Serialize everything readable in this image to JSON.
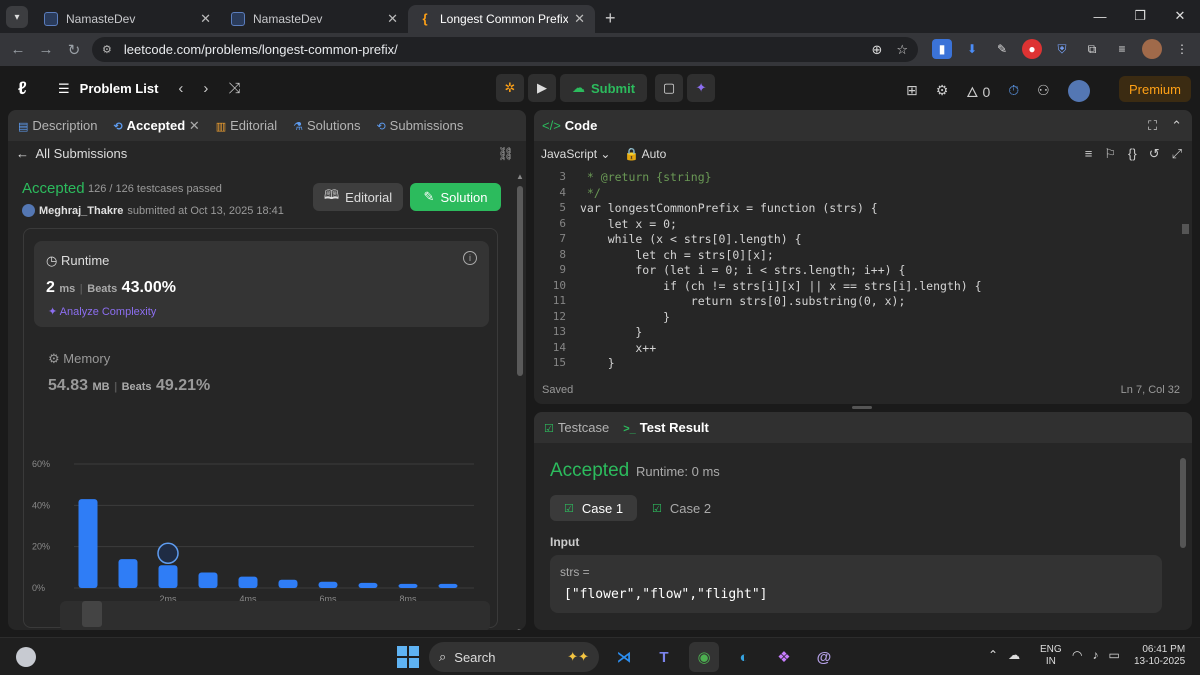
{
  "browser": {
    "tabs": [
      {
        "title": "NamasteDev"
      },
      {
        "title": "NamasteDev"
      },
      {
        "title": "Longest Common Prefix - LeetC"
      }
    ],
    "url": "leetcode.com/problems/longest-common-prefix/"
  },
  "header": {
    "problem_list": "Problem List",
    "submit": "Submit",
    "streak": "0",
    "premium": "Premium"
  },
  "left": {
    "tabs": [
      {
        "label": "Description"
      },
      {
        "label": "Accepted"
      },
      {
        "label": "Editorial"
      },
      {
        "label": "Solutions"
      },
      {
        "label": "Submissions"
      }
    ],
    "all_submissions": "All Submissions",
    "status": "Accepted",
    "testcases": "126 / 126 testcases passed",
    "user": "Meghraj_Thakre",
    "submitted_at": "submitted at Oct 13, 2025 18:41",
    "editorial_btn": "Editorial",
    "solution_btn": "Solution",
    "runtime": {
      "title": "Runtime",
      "value": "2",
      "unit": "ms",
      "beats_label": "Beats",
      "beats": "43.00%",
      "analyze": "Analyze Complexity"
    },
    "memory": {
      "title": "Memory",
      "value": "54.83",
      "unit": "MB",
      "beats_label": "Beats",
      "beats": "49.21%"
    }
  },
  "chart_data": {
    "type": "bar",
    "categories": [
      "0ms",
      "1ms",
      "2ms",
      "3ms",
      "4ms",
      "5ms",
      "6ms",
      "7ms",
      "8ms",
      "9ms"
    ],
    "values": [
      43,
      14,
      11,
      7.5,
      5.5,
      4,
      3,
      2.5,
      2,
      2
    ],
    "x_tick_labels": [
      "2ms",
      "4ms",
      "6ms",
      "8ms"
    ],
    "y_ticks": [
      "0%",
      "20%",
      "40%",
      "60%"
    ],
    "ylim": [
      0,
      60
    ],
    "highlight_category": "2ms",
    "bar_color": "#2f7df6"
  },
  "code": {
    "title": "Code",
    "language": "JavaScript",
    "mode": "Auto",
    "status": "Saved",
    "cursor": "Ln 7, Col 32",
    "lines": [
      {
        "n": "3",
        "text": " * @return {string}"
      },
      {
        "n": "4",
        "text": " */"
      },
      {
        "n": "5",
        "text": "var longestCommonPrefix = function (strs) {"
      },
      {
        "n": "6",
        "text": "    let x = 0;"
      },
      {
        "n": "7",
        "text": "    while (x < strs[0].length) {"
      },
      {
        "n": "8",
        "text": "        let ch = strs[0][x];"
      },
      {
        "n": "9",
        "text": "        for (let i = 0; i < strs.length; i++) {"
      },
      {
        "n": "10",
        "text": "            if (ch != strs[i][x] || x == strs[i].length) {"
      },
      {
        "n": "11",
        "text": "                return strs[0].substring(0, x);"
      },
      {
        "n": "12",
        "text": "            }"
      },
      {
        "n": "13",
        "text": "        }"
      },
      {
        "n": "14",
        "text": "        x++"
      },
      {
        "n": "15",
        "text": "    }"
      }
    ]
  },
  "test": {
    "tab_testcase": "Testcase",
    "tab_result": "Test Result",
    "status": "Accepted",
    "runtime": "Runtime: 0 ms",
    "case1": "Case 1",
    "case2": "Case 2",
    "input_label": "Input",
    "param_name": "strs =",
    "param_value": "[\"flower\",\"flow\",\"flight\"]"
  },
  "taskbar": {
    "search": "Search",
    "lang_line1": "ENG",
    "lang_line2": "IN",
    "time": "06:41 PM",
    "date": "13-10-2025"
  }
}
